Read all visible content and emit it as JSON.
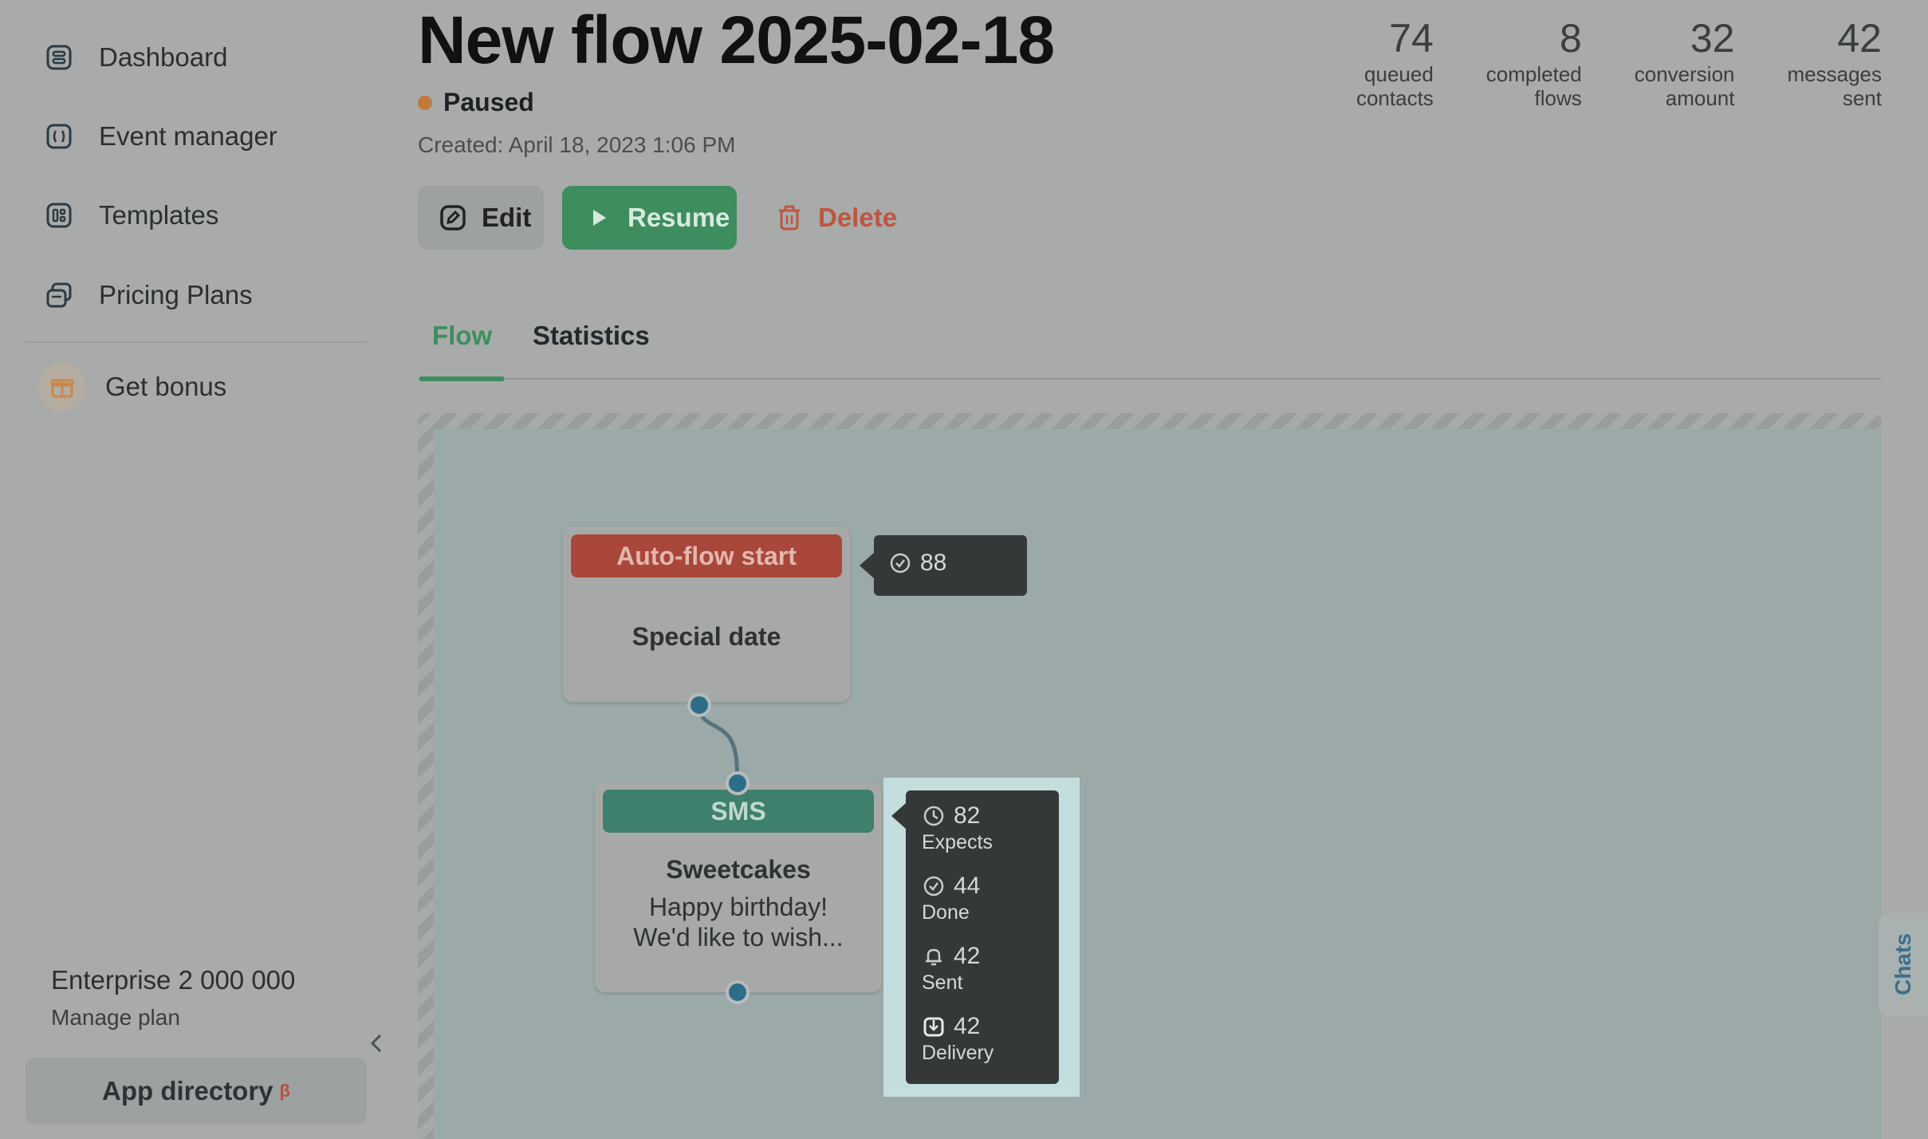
{
  "sidebar": {
    "items": [
      {
        "label": "Dashboard",
        "icon": "dashboard-icon"
      },
      {
        "label": "Event manager",
        "icon": "event-manager-icon"
      },
      {
        "label": "Templates",
        "icon": "templates-icon"
      },
      {
        "label": "Pricing Plans",
        "icon": "pricing-plans-icon"
      }
    ],
    "bonus": {
      "label": "Get bonus",
      "icon": "gift-icon"
    },
    "plan": {
      "name": "Enterprise 2 000 000",
      "link": "Manage plan"
    },
    "app_directory": {
      "label": "App directory",
      "badge": "β"
    }
  },
  "header": {
    "title": "New flow 2025-02-18",
    "status": "Paused",
    "status_color": "#c07a3a",
    "created": "Created: April 18, 2023 1:06 PM"
  },
  "stats": [
    {
      "value": "74",
      "line1": "queued",
      "line2": "contacts"
    },
    {
      "value": "8",
      "line1": "completed",
      "line2": "flows"
    },
    {
      "value": "32",
      "line1": "conversion",
      "line2": "amount"
    },
    {
      "value": "42",
      "line1": "messages",
      "line2": "sent"
    }
  ],
  "actions": {
    "edit": "Edit",
    "resume": "Resume",
    "delete": "Delete"
  },
  "tabs": {
    "flow": "Flow",
    "statistics": "Statistics",
    "active": "Flow"
  },
  "flow": {
    "start_node": {
      "header": "Auto-flow start",
      "title": "Special date",
      "tooltip_count": "88"
    },
    "sms_node": {
      "header": "SMS",
      "title": "Sweetcakes",
      "body_line1": "Happy birthday!",
      "body_line2": "We'd like to wish...",
      "stats": [
        {
          "value": "82",
          "label": "Expects",
          "icon": "clock-icon"
        },
        {
          "value": "44",
          "label": "Done",
          "icon": "check-circle-icon"
        },
        {
          "value": "42",
          "label": "Sent",
          "icon": "bell-icon"
        },
        {
          "value": "42",
          "label": "Delivery",
          "icon": "delivery-icon"
        }
      ]
    }
  },
  "chats": {
    "label": "Chats"
  },
  "colors": {
    "accent_green": "#3e8d5e",
    "danger": "#c0553f",
    "port": "#2c6e8a"
  }
}
